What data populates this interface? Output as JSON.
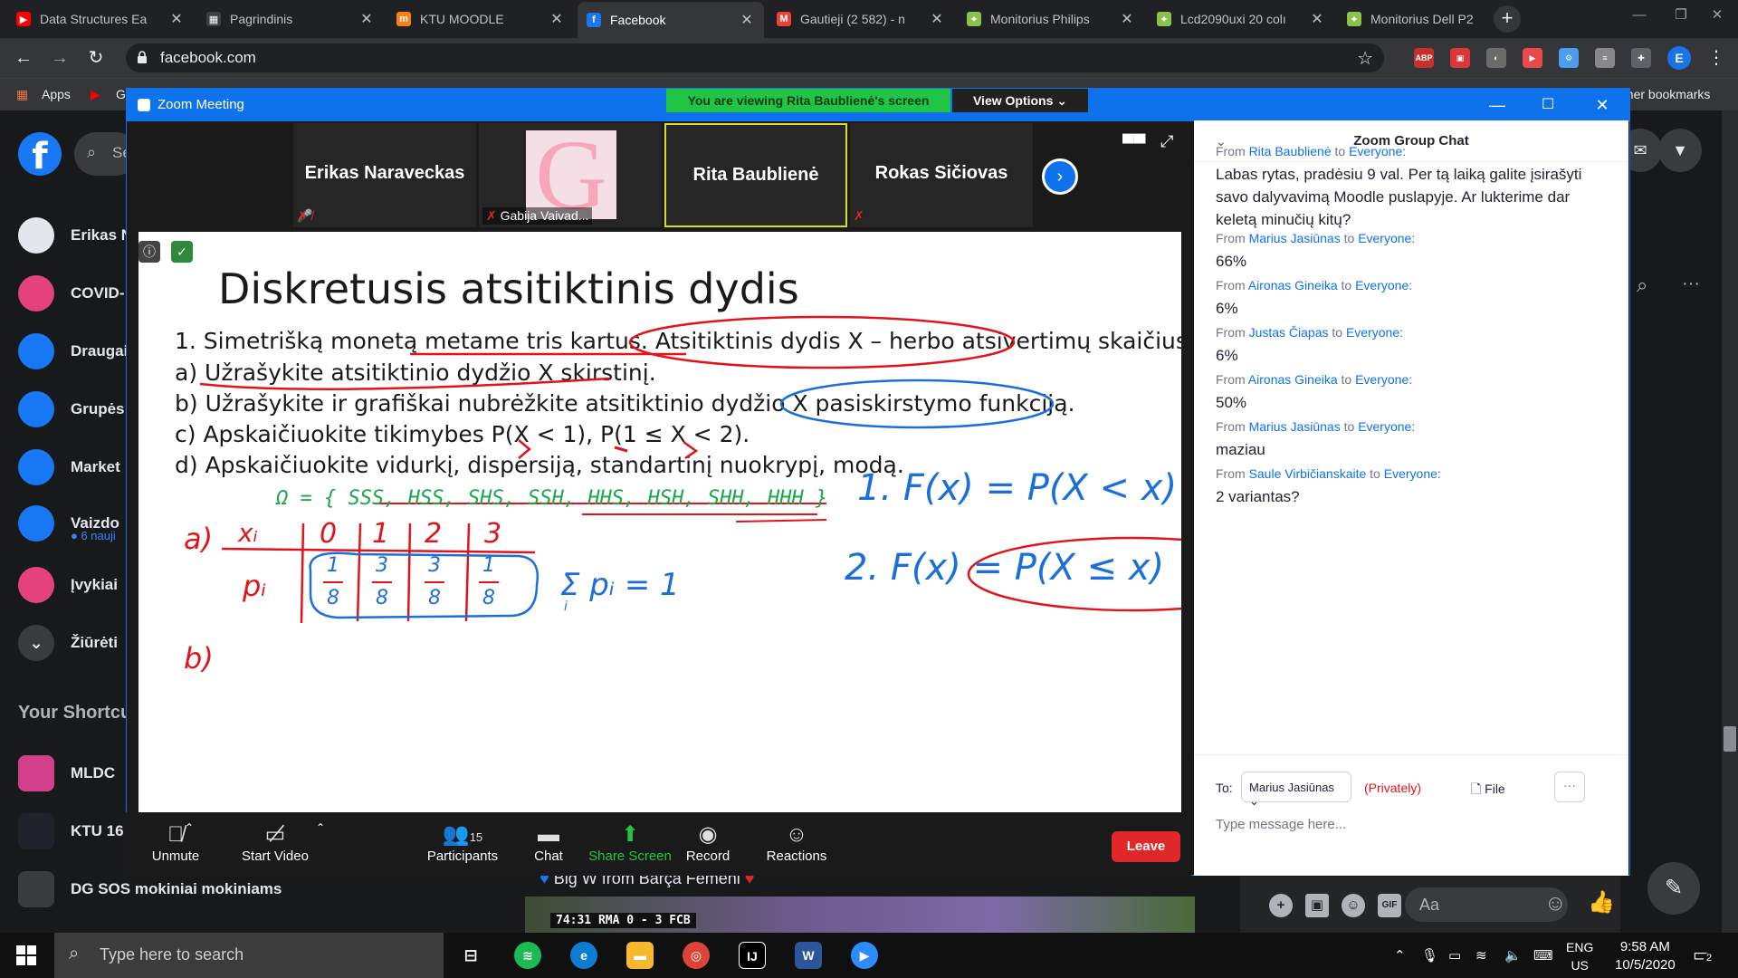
{
  "browser": {
    "tabs": [
      {
        "title": "Data Structures Ea",
        "icon": "youtube-icon",
        "color": "#ff0000",
        "glyph": "▶"
      },
      {
        "title": "Pagrindinis",
        "icon": "bookmark-icon",
        "color": "#3c4043",
        "glyph": "▦"
      },
      {
        "title": "KTU MOODLE",
        "icon": "moodle-icon",
        "color": "#f98012",
        "glyph": "m"
      },
      {
        "title": "Facebook",
        "icon": "facebook-icon",
        "color": "#1877f2",
        "glyph": "f"
      },
      {
        "title": "Gautieji (2 582) - n",
        "icon": "gmail-icon",
        "color": "#ea4335",
        "glyph": "M"
      },
      {
        "title": "Monitorius Philips",
        "icon": "shop-icon",
        "color": "#8bc34a",
        "glyph": "✦"
      },
      {
        "title": "Lcd2090uxi 20 colı",
        "icon": "shop-icon",
        "color": "#8bc34a",
        "glyph": "✦"
      },
      {
        "title": "Monitorius Dell P2",
        "icon": "shop-icon",
        "color": "#8bc34a",
        "glyph": "✦"
      }
    ],
    "url": "facebook.com",
    "extensions": [
      {
        "label": "ABP",
        "color": "#c4302b"
      },
      {
        "label": "▣",
        "color": "#d9373a"
      },
      {
        "label": "◐",
        "color": "#6b6b6b"
      },
      {
        "label": "▶",
        "color": "#e64a4a"
      },
      {
        "label": "⚙",
        "color": "#4a9df0"
      },
      {
        "label": "≡",
        "color": "#888888"
      },
      {
        "label": "✚",
        "color": "#5f6368"
      }
    ],
    "profile_initial": "E",
    "bookmarks": {
      "apps": "Apps",
      "other": "Other bookmarks",
      "yt_short": "G"
    }
  },
  "facebook": {
    "search_placeholder": "Se",
    "sidebar": [
      {
        "label": "Erikas N",
        "icon": "avatar-icon",
        "color": "#e4e6eb"
      },
      {
        "label": "COVID-",
        "icon": "covid-heart-icon",
        "color": "#e3427a"
      },
      {
        "label": "Draugai",
        "icon": "friends-icon",
        "color": "#1877f2"
      },
      {
        "label": "Grupės",
        "icon": "groups-icon",
        "color": "#1877f2"
      },
      {
        "label": "Market",
        "icon": "marketplace-icon",
        "color": "#1877f2"
      },
      {
        "label": "Vaizdo",
        "icon": "watch-icon",
        "color": "#1877f2",
        "sub": "● 6 nauji"
      },
      {
        "label": "Įvykiai",
        "icon": "events-icon",
        "color": "#e3427a"
      },
      {
        "label": "Žiūrėti",
        "icon": "chevron-down-icon",
        "color": "#3a3b3c"
      }
    ],
    "shortcuts_heading": "Your Shortcu",
    "shortcuts": [
      {
        "label": "MLDC",
        "icon": "rainbow-icon",
        "color": "#d13f8a"
      },
      {
        "label": "KTU 16",
        "icon": "ktu-icon",
        "color": "#20232a"
      },
      {
        "label": "DG SOS mokiniai mokiniams",
        "icon": "group-icon",
        "color": "#3a3b3c"
      }
    ],
    "story_title": "Big W from Barça Femeni",
    "score": "74:31   RMA   0 - 3   FCB",
    "chat_input_placeholder": "Aa"
  },
  "zoom": {
    "window_title": "Zoom Meeting",
    "banner": "You are viewing Rita Baublienė's screen",
    "view_options": "View Options ⌄",
    "participants": [
      {
        "name": "Erikas Naraveckas",
        "muted": true
      },
      {
        "name": "Gabija Vaivad...",
        "muted": true,
        "has_image": true
      },
      {
        "name": "Rita Baublienė",
        "speaking": true
      },
      {
        "name": "Rokas Sičiovas",
        "muted": true
      }
    ],
    "controls": {
      "unmute": "Unmute",
      "start_video": "Start Video",
      "participants": "Participants",
      "participants_count": "15",
      "chat": "Chat",
      "share_screen": "Share Screen",
      "record": "Record",
      "reactions": "Reactions",
      "leave": "Leave"
    },
    "chat": {
      "title": "Zoom Group Chat",
      "from_label": "From",
      "to_label": "to",
      "messages": [
        {
          "from": "Rita Baublienė",
          "to": "Everyone:",
          "text": "Labas rytas, pradėsiu 9 val. Per tą laiką galite įsirašyti savo dalyvavimą Moodle puslapyje. Ar lukterime dar keletą minučių kitų?"
        },
        {
          "from": "Marius Jasiūnas",
          "to": "Everyone:",
          "text": "66%"
        },
        {
          "from": "Aironas Gineika",
          "to": "Everyone:",
          "text": "6%"
        },
        {
          "from": "Justas Čiapas",
          "to": "Everyone:",
          "text": "6%"
        },
        {
          "from": "Aironas Gineika",
          "to": "Everyone:",
          "text": "50%"
        },
        {
          "from": "Marius Jasiūnas",
          "to": "Everyone:",
          "text": "maziau"
        },
        {
          "from": "Saule Virbičianskaite",
          "to": "Everyone:",
          "text": "2 variantas?"
        }
      ],
      "to": "To:",
      "recipient": "Marius Jasiūnas ⌄",
      "privately": "(Privately)",
      "file": "File",
      "placeholder": "Type message here..."
    }
  },
  "board": {
    "title": "Diskretusis atsitiktinis dydis",
    "lines": [
      "1.  Simetrišką monetą metame tris kartus. Atsitiktinis dydis X – herbo atsivertimų skaičius.",
      "a) Užrašykite atsitiktinio dydžio X skirstinį.",
      "b) Užrašykite ir grafiškai nubrėžkite atsitiktinio dydžio X pasiskirstymo funkciją.",
      "c) Apskaičiuokite tikimybes P(X < 1), P(1 ≤ X < 2).",
      "d) Apskaičiuokite vidurkį, dispersiją, standartinį nuokrypį, modą."
    ],
    "handwriting": {
      "omega": "Ω = { SSS, HSS, SHS, SSH,  HHS, HSH, SHH, HHH }",
      "f1": "1.  F(x) = P(X < x)",
      "f2": "2.  F(x) = P(X ≤ x)",
      "a_label": "a)",
      "b_label": "b)",
      "xi_label": "xᵢ",
      "pi_label": "pᵢ",
      "x_values": [
        "0",
        "1",
        "2",
        "3"
      ],
      "p_values": [
        {
          "num": "1",
          "den": "8"
        },
        {
          "num": "3",
          "den": "8"
        },
        {
          "num": "3",
          "den": "8"
        },
        {
          "num": "1",
          "den": "8"
        }
      ],
      "sum": "Σ pᵢ = 1",
      "sum_index": "i"
    }
  },
  "taskbar": {
    "search_placeholder": "Type here to search",
    "lang": "ENG",
    "region": "US",
    "time": "9:58 AM",
    "date": "10/5/2020",
    "notifications": "2"
  }
}
